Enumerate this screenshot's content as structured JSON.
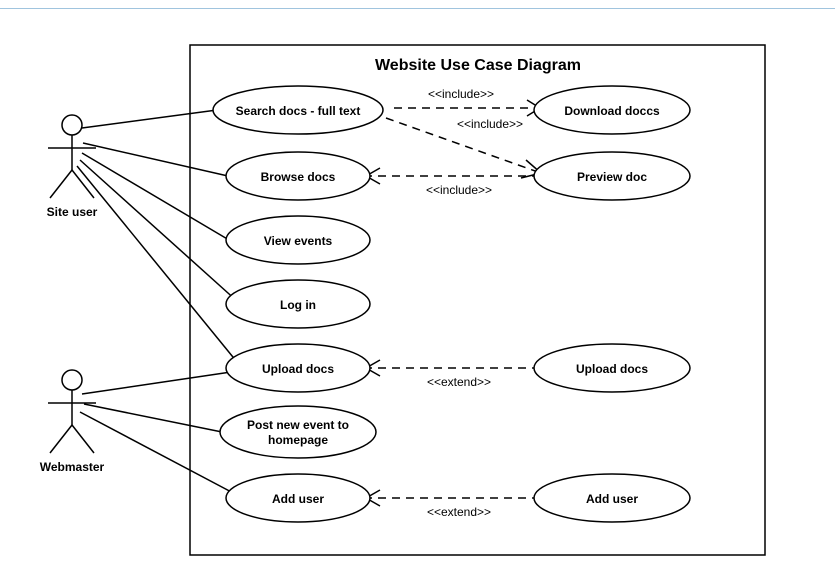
{
  "title": "Website Use Case Diagram",
  "actors": {
    "siteUser": {
      "label": "Site user"
    },
    "webmaster": {
      "label": "Webmaster"
    }
  },
  "useCases": {
    "search": {
      "label": "Search docs - full text"
    },
    "browse": {
      "label": "Browse docs"
    },
    "viewEvents": {
      "label": "View events"
    },
    "login": {
      "label": "Log in"
    },
    "upload": {
      "label": "Upload docs"
    },
    "postEvent": {
      "label1": "Post new event to",
      "label2": "homepage"
    },
    "addUser": {
      "label": "Add user"
    },
    "download": {
      "label": "Download doccs"
    },
    "preview": {
      "label": "Preview doc"
    },
    "uploadR": {
      "label": "Upload docs"
    },
    "addUserR": {
      "label": "Add user"
    }
  },
  "relLabels": {
    "inc1": "<<include>>",
    "inc2": "<<include>>",
    "inc3": "<<include>>",
    "ext1": "<<extend>>",
    "ext2": "<<extend>>"
  }
}
